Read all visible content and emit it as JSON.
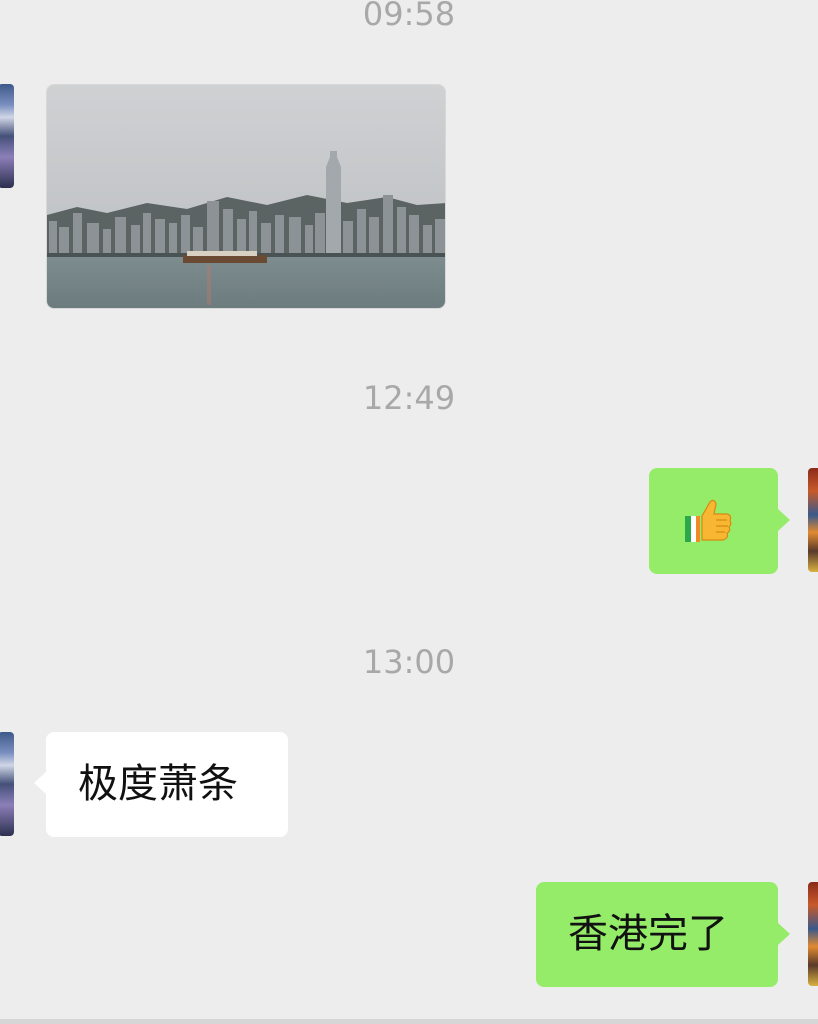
{
  "chat": {
    "timestamps": [
      "09:58",
      "12:49",
      "13:00"
    ],
    "messages": {
      "photo": {
        "sender": "other",
        "type": "image",
        "icon": "harbour-skyline-photo"
      },
      "like": {
        "sender": "me",
        "type": "emoji",
        "icon": "thumbs-up-icon"
      },
      "text1": {
        "sender": "other",
        "type": "text",
        "text": "极度萧条"
      },
      "text2": {
        "sender": "me",
        "type": "text",
        "text": "香港完了"
      }
    }
  },
  "colors": {
    "background": "#ededed",
    "bubble_me": "#95ec69",
    "bubble_other": "#ffffff",
    "timestamp_text": "#a8a8a8"
  }
}
